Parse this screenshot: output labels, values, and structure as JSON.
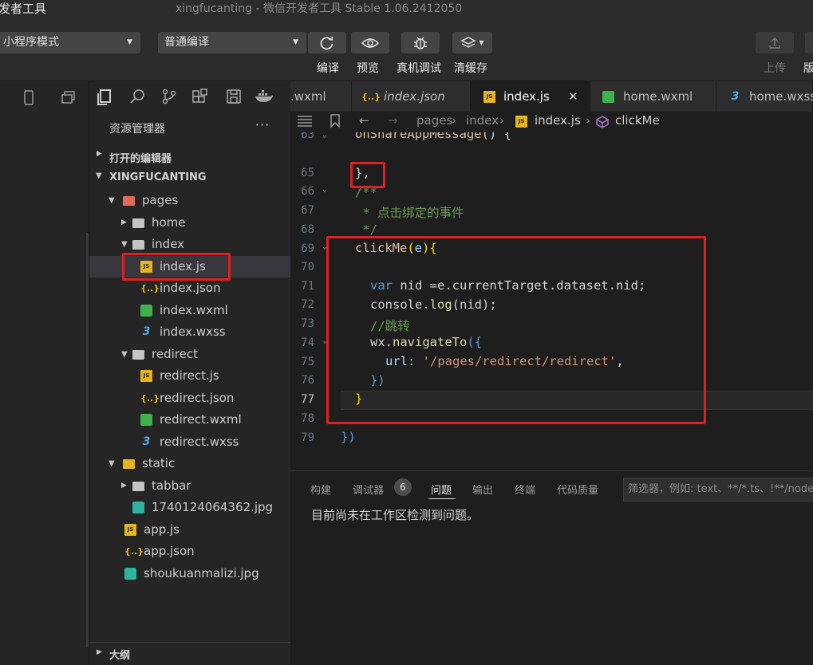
{
  "titlebar": {
    "app_name": "发者工具",
    "window_title": "xingfucanting - 微信开发者工具 Stable 1.06.2412050"
  },
  "toolbar": {
    "mode_select": "小程序模式",
    "compile_select": "普通编译",
    "compile_label": "编译",
    "preview_label": "预览",
    "debug_label": "真机调试",
    "clearcache_label": "清缓存",
    "upload_label": "上传",
    "version_label": "版"
  },
  "explorer": {
    "title": "资源管理器",
    "more": "···",
    "open_editors": "打开的编辑器",
    "project": "XINGFUCANTING",
    "outline": "大纲",
    "tree": [
      {
        "label": "pages",
        "type": "folder-pages",
        "arrow": "▾"
      },
      {
        "label": "home",
        "type": "folder",
        "arrow": "▸"
      },
      {
        "label": "index",
        "type": "folder",
        "arrow": "▾"
      },
      {
        "label": "index.js",
        "type": "js",
        "arrow": ""
      },
      {
        "label": "index.json",
        "type": "json",
        "arrow": ""
      },
      {
        "label": "index.wxml",
        "type": "wxml",
        "arrow": ""
      },
      {
        "label": "index.wxss",
        "type": "wxss",
        "arrow": ""
      },
      {
        "label": "redirect",
        "type": "folder",
        "arrow": "▾"
      },
      {
        "label": "redirect.js",
        "type": "js",
        "arrow": ""
      },
      {
        "label": "redirect.json",
        "type": "json",
        "arrow": ""
      },
      {
        "label": "redirect.wxml",
        "type": "wxml",
        "arrow": ""
      },
      {
        "label": "redirect.wxss",
        "type": "wxss",
        "arrow": ""
      },
      {
        "label": "static",
        "type": "folder-static",
        "arrow": "▾"
      },
      {
        "label": "tabbar",
        "type": "folder",
        "arrow": "▸"
      },
      {
        "label": "1740124064362.jpg",
        "type": "jpg",
        "arrow": ""
      },
      {
        "label": "app.js",
        "type": "js",
        "arrow": ""
      },
      {
        "label": "app.json",
        "type": "json",
        "arrow": ""
      },
      {
        "label": "shoukuanmalizi.jpg",
        "type": "jpg",
        "arrow": ""
      }
    ]
  },
  "tabs": [
    {
      "label": ".wxml",
      "icon": "none"
    },
    {
      "label": "index.json",
      "icon": "json"
    },
    {
      "label": "index.js",
      "icon": "js",
      "close": "✕"
    },
    {
      "label": "home.wxml",
      "icon": "wxml"
    },
    {
      "label": "home.wxss",
      "icon": "wxss"
    }
  ],
  "breadcrumb": {
    "seg1": "pages",
    "seg2": "index",
    "seg3": "index.js",
    "seg4": "clickMe"
  },
  "editor": {
    "line_numbers": [
      "63",
      "65",
      "66",
      "67",
      "68",
      "69",
      "70",
      "71",
      "72",
      "73",
      "74",
      "75",
      "76",
      "77",
      "78",
      "79"
    ],
    "lines": {
      "l63_fn": "onShareAppMessage",
      "l63_rest": "() {",
      "l65": "},",
      "l66": "/**",
      "l67": " * 点击绑定的事件",
      "l68": " */",
      "l69_fn": "clickMe",
      "l69_p1": "(",
      "l69_arg": "e",
      "l69_p2": "){",
      "l71_kw": "var",
      "l71_rest": " nid =e.currentTarget.dataset.nid;",
      "l72_a": "console.",
      "l72_fn": "log",
      "l72_b": "(nid);",
      "l73": "//跳转",
      "l74_a": "wx.",
      "l74_fn": "navigateTo",
      "l74_b": "({",
      "l75_key": "url",
      "l75_colon": ": ",
      "l75_str": "'/pages/redirect/redirect'",
      "l75_comma": ",",
      "l76": "})",
      "l77": "}",
      "l79": "})"
    }
  },
  "panel": {
    "tab_build": "构建",
    "tab_debugger": "调试器",
    "debugger_badge": "6",
    "tab_problems": "问题",
    "tab_output": "输出",
    "tab_terminal": "终端",
    "tab_quality": "代码质量",
    "filter_placeholder": "筛选器，例如: text、**/*.ts、!**/node_modules/**",
    "message": "目前尚未在工作区检测到问题。"
  }
}
